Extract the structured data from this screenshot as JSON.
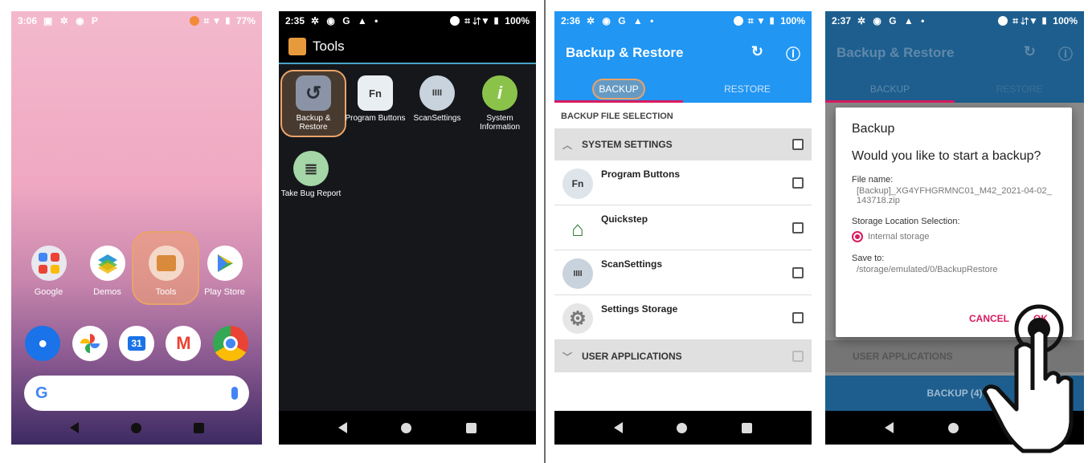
{
  "phone1": {
    "status": {
      "time": "3:06",
      "icons": "▣ ✲ ◉ P",
      "battery": "77%",
      "signal": "⌗ ▼ ▮"
    },
    "apps": [
      {
        "label": "Google",
        "icon": "google-folder-icon"
      },
      {
        "label": "Demos",
        "icon": "demos-stack-icon"
      },
      {
        "label": "Tools",
        "icon": "tools-folder-icon"
      },
      {
        "label": "Play Store",
        "icon": "play-store-icon"
      }
    ],
    "dock_icons": [
      "contacts-icon",
      "photos-icon",
      "calendar-icon",
      "gmail-icon",
      "chrome-icon"
    ],
    "calendar_day": "31",
    "search_logo": "G"
  },
  "phone2": {
    "status": {
      "time": "2:35",
      "icons": "✲ ◉ G ▲ •",
      "battery": "100%",
      "signal": "⌗ ⇵▼ ▮"
    },
    "title": "Tools",
    "tools": [
      {
        "label": "Backup & Restore",
        "glyph": "↺"
      },
      {
        "label": "Program Buttons",
        "glyph": "Fn"
      },
      {
        "label": "ScanSettings",
        "glyph": "IIII"
      },
      {
        "label": "System Information",
        "glyph": "i"
      },
      {
        "label": "Take Bug Report",
        "glyph": "≣"
      }
    ]
  },
  "phone3": {
    "status": {
      "time": "2:36",
      "icons": "✲ ◉ G ▲ •",
      "battery": "100%",
      "signal": "⌗ ▼ ▮"
    },
    "title": "Backup & Restore",
    "refresh_glyph": "↻",
    "info_glyph": "ⓘ",
    "tabs": [
      "BACKUP",
      "RESTORE"
    ],
    "section": "BACKUP FILE SELECTION",
    "group_system": "SYSTEM SETTINGS",
    "group_user": "USER APPLICATIONS",
    "items": [
      {
        "label": "Program Buttons",
        "glyph": "Fn"
      },
      {
        "label": "Quickstep",
        "glyph": "⌂"
      },
      {
        "label": "ScanSettings",
        "glyph": "IIII"
      },
      {
        "label": "Settings Storage",
        "glyph": "⚙"
      }
    ]
  },
  "phone4": {
    "status": {
      "time": "2:37",
      "icons": "✲ ◉ G ▲ •",
      "battery": "100%",
      "signal": "⌗ ⇵▼ ▮"
    },
    "title": "Backup & Restore",
    "tabs": [
      "BACKUP",
      "RESTORE"
    ],
    "group_user": "USER APPLICATIONS",
    "bottom_button": "BACKUP (4)",
    "dialog": {
      "title": "Backup",
      "question": "Would you like to start a backup?",
      "file_label": "File name:",
      "file_value": "[Backup]_XG4YFHGRMNC01_M42_2021-04-02_143718.zip",
      "storage_label": "Storage Location Selection:",
      "storage_option": "Internal storage",
      "save_label": "Save to:",
      "save_value": "/storage/emulated/0/BackupRestore",
      "cancel": "CANCEL",
      "ok": "OK"
    }
  },
  "colors": {
    "accent": "#2196f3",
    "pink": "#d81b60",
    "highlight": "#e9a36a",
    "dark_bar": "#1d5e8e"
  }
}
